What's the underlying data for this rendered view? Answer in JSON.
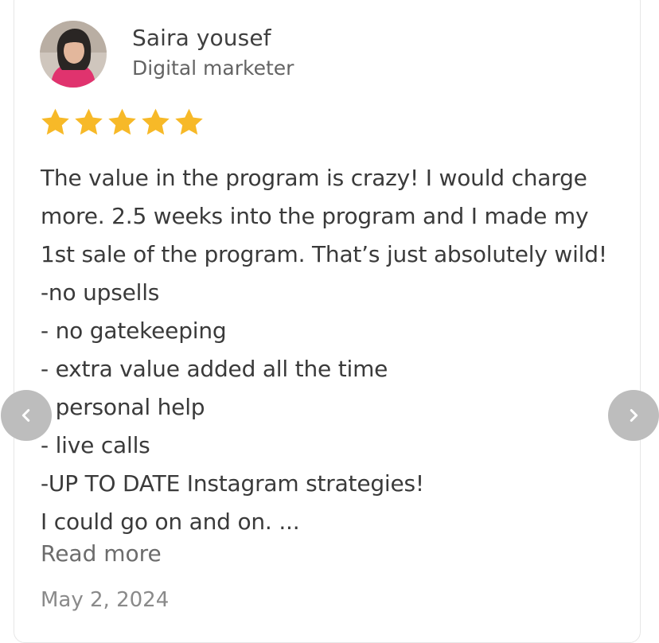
{
  "reviewer": {
    "name": "Saira yousef",
    "role": "Digital marketer",
    "avatar_icon": "person-photo"
  },
  "rating": {
    "stars": 5,
    "max": 5,
    "color": "#F7B928"
  },
  "review": {
    "lines": [
      "The value in the program is crazy! I would charge",
      "more. 2.5 weeks into the program and I made my",
      "1st sale of the program. That’s just absolutely wild!",
      "-no upsells",
      "- no gatekeeping",
      "- extra value added all the time",
      "- personal help",
      "- live calls",
      "-UP TO DATE Instagram strategies!",
      "I could go on and on. ..."
    ],
    "read_more": "Read more",
    "date": "May 2, 2024"
  },
  "navigation": {
    "prev_icon": "chevron-left-icon",
    "next_icon": "chevron-right-icon",
    "button_color": "#BDBDBD"
  }
}
